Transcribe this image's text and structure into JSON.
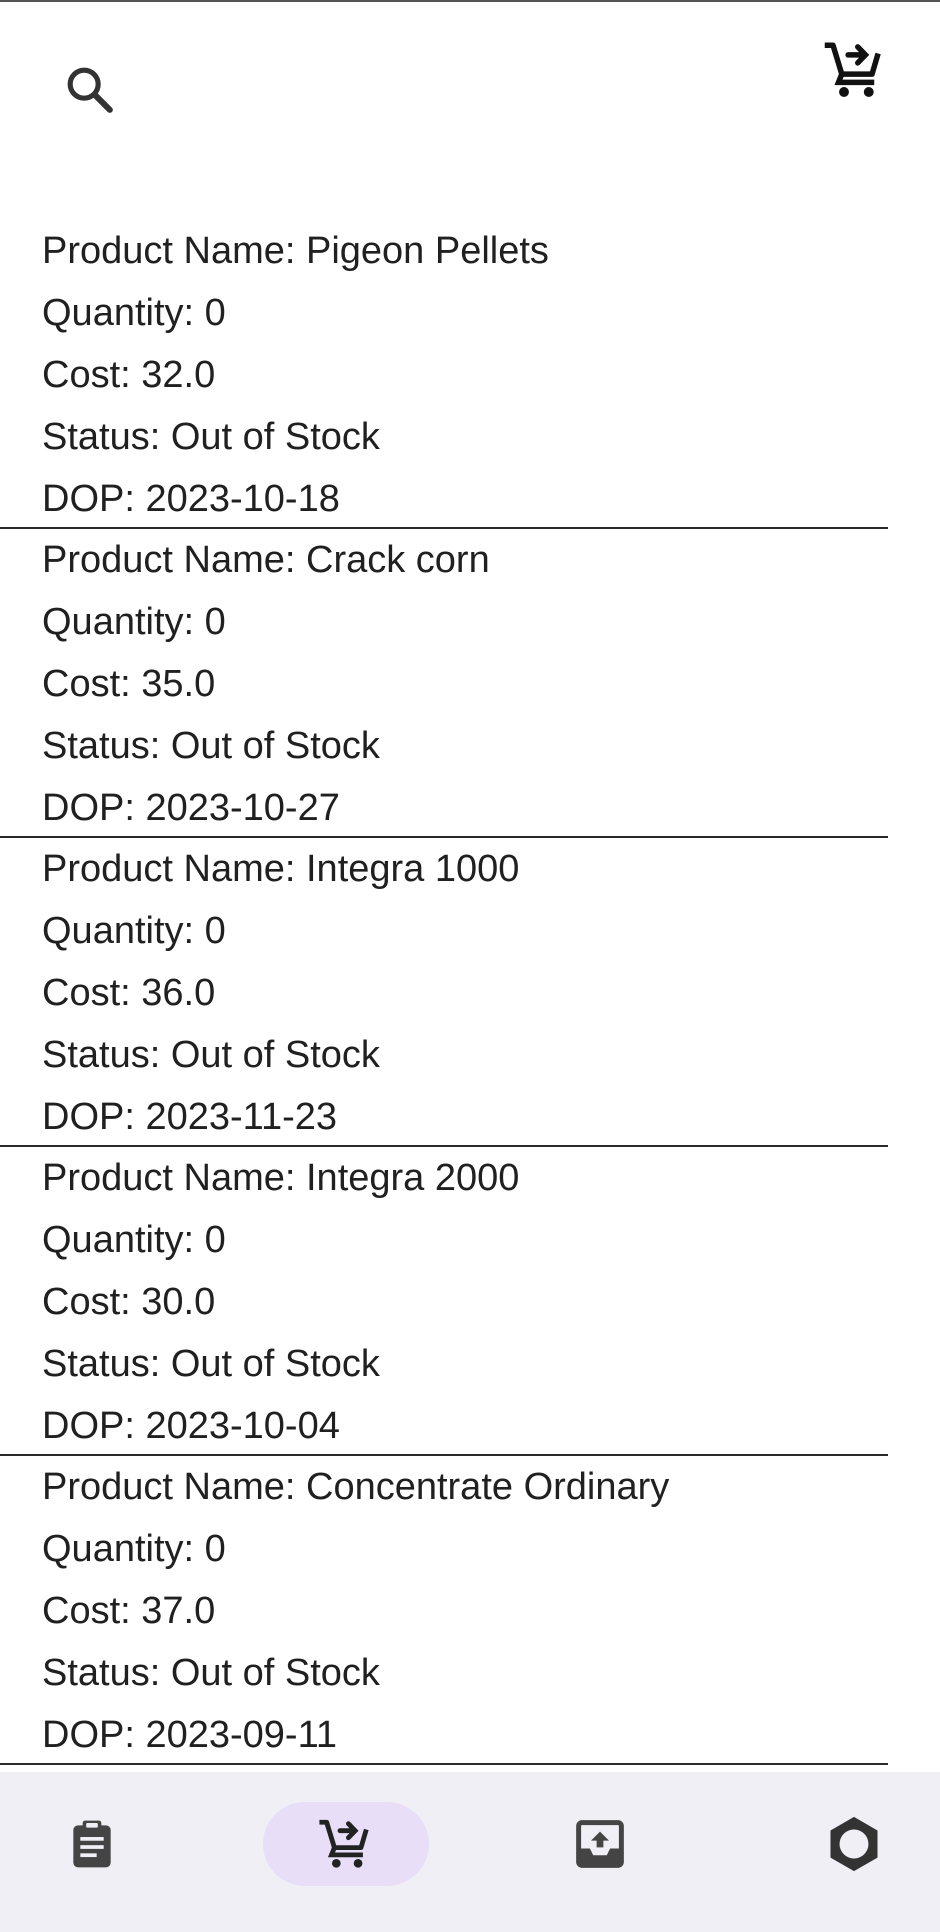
{
  "top_bar": {
    "search_icon": "search-icon",
    "cart_icon": "add-shopping-cart-icon"
  },
  "products": [
    {
      "name_line": "Product Name: Pigeon Pellets",
      "quantity_line": "Quantity: 0",
      "cost_line": "Cost: 32.0",
      "status_line": "Status: Out of Stock",
      "dop_line": "DOP: 2023-10-18"
    },
    {
      "name_line": "Product Name: Crack corn",
      "quantity_line": "Quantity: 0",
      "cost_line": "Cost: 35.0",
      "status_line": "Status: Out of Stock",
      "dop_line": "DOP: 2023-10-27"
    },
    {
      "name_line": "Product Name: Integra 1000",
      "quantity_line": "Quantity: 0",
      "cost_line": "Cost: 36.0",
      "status_line": "Status: Out of Stock",
      "dop_line": "DOP: 2023-11-23"
    },
    {
      "name_line": "Product Name: Integra 2000",
      "quantity_line": "Quantity: 0",
      "cost_line": "Cost: 30.0",
      "status_line": "Status: Out of Stock",
      "dop_line": "DOP: 2023-10-04"
    },
    {
      "name_line": "Product Name: Concentrate Ordinary",
      "quantity_line": "Quantity: 0",
      "cost_line": "Cost: 37.0",
      "status_line": "Status: Out of Stock",
      "dop_line": "DOP: 2023-09-11"
    }
  ],
  "bottom_nav": {
    "items": [
      {
        "icon": "clipboard-icon",
        "active": false
      },
      {
        "icon": "add-shopping-cart-icon",
        "active": true
      },
      {
        "icon": "upload-box-icon",
        "active": false
      },
      {
        "icon": "settings-gear-icon",
        "active": false
      }
    ],
    "active_pill_color": "#e8def8",
    "background_color": "#f1eff6"
  }
}
